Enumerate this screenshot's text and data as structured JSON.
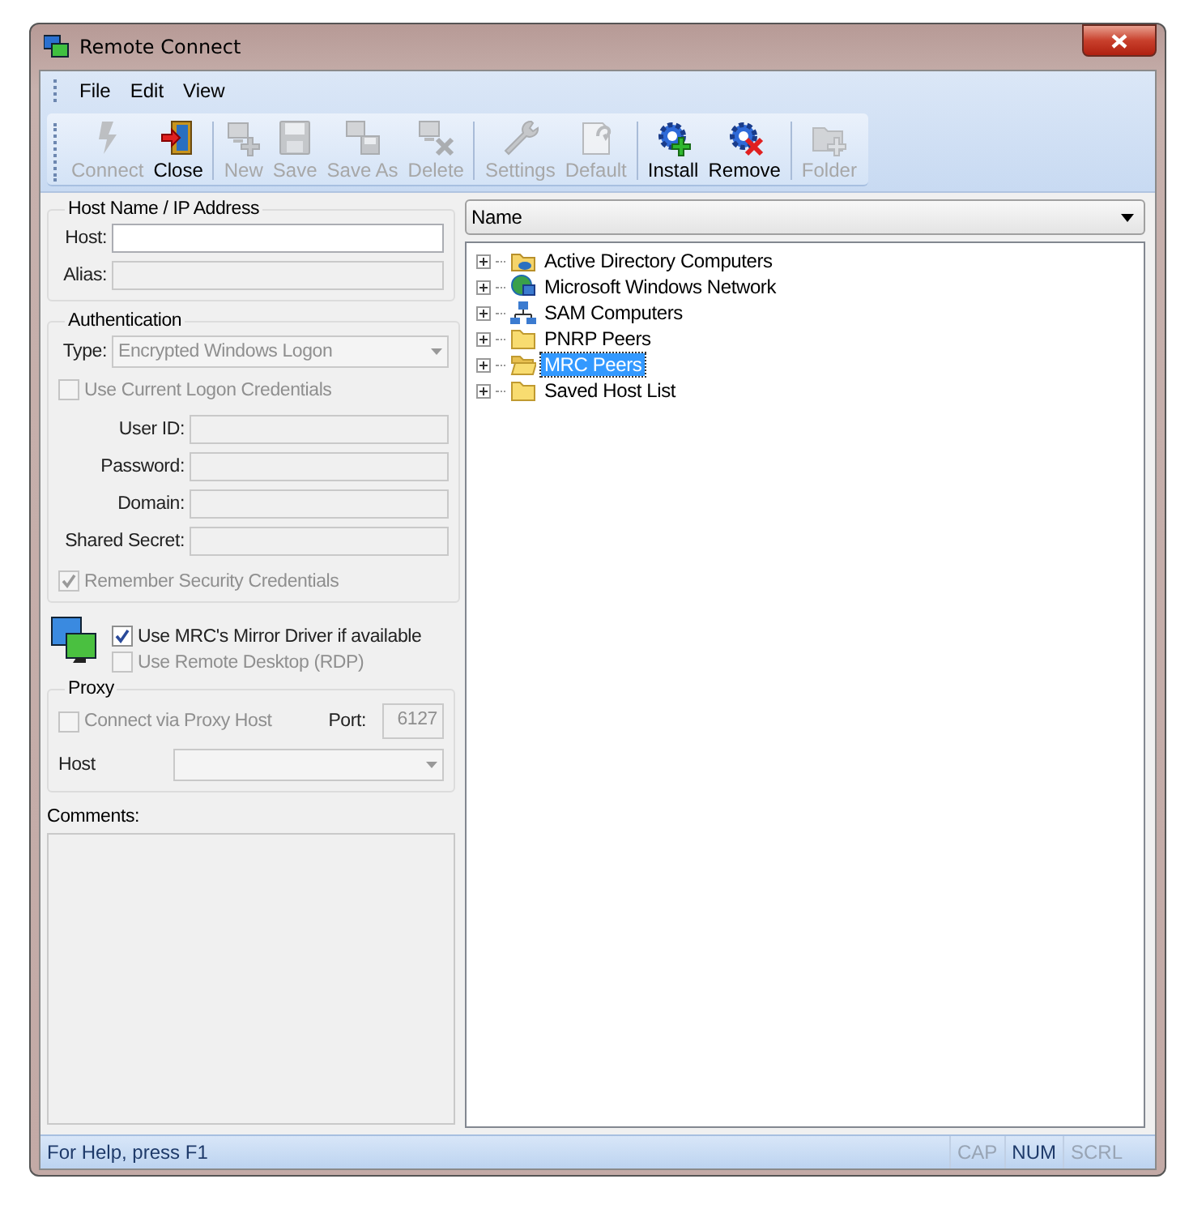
{
  "window": {
    "title": "Remote Connect"
  },
  "menu": [
    {
      "label": "File"
    },
    {
      "label": "Edit"
    },
    {
      "label": "View"
    }
  ],
  "toolbar": [
    {
      "buttons": [
        {
          "label": "Connect",
          "kind": "bolt",
          "disabled": true
        },
        {
          "label": "Close",
          "kind": "door",
          "disabled": false
        }
      ]
    },
    {
      "buttons": [
        {
          "label": "New",
          "kind": "computer-plus",
          "disabled": true
        },
        {
          "label": "Save",
          "kind": "floppy",
          "disabled": true
        },
        {
          "label": "Save As",
          "kind": "computer-floppy",
          "disabled": true
        },
        {
          "label": "Delete",
          "kind": "computer-x",
          "disabled": true
        }
      ]
    },
    {
      "buttons": [
        {
          "label": "Settings",
          "kind": "wrench",
          "disabled": true
        },
        {
          "label": "Default",
          "kind": "page",
          "disabled": true
        }
      ]
    },
    {
      "buttons": [
        {
          "label": "Install",
          "kind": "gear-plus",
          "disabled": false
        },
        {
          "label": "Remove",
          "kind": "gear-x",
          "disabled": false
        }
      ]
    },
    {
      "buttons": [
        {
          "label": "Folder",
          "kind": "folder-plus",
          "disabled": true
        }
      ]
    }
  ],
  "host_section": {
    "title": "Host Name / IP Address",
    "fields": [
      {
        "label": "Host:",
        "disabled": false
      },
      {
        "label": "Alias:",
        "disabled": true
      }
    ]
  },
  "authentication": {
    "title": "Authentication",
    "type_label": "Type:",
    "type_value": "Encrypted Windows Logon",
    "type_disabled": true,
    "use_current": {
      "label": "Use Current Logon Credentials",
      "checked": false,
      "disabled": true
    },
    "fields": [
      {
        "label": "User ID:",
        "disabled": true
      },
      {
        "label": "Password:",
        "disabled": true
      },
      {
        "label": "Domain:",
        "disabled": true
      },
      {
        "label": "Shared Secret:",
        "disabled": true
      }
    ],
    "remember": {
      "label": "Remember Security Credentials",
      "checked": true,
      "disabled": true
    }
  },
  "options": [
    {
      "label": "Use MRC's Mirror Driver if available",
      "checked": true,
      "disabled": false
    },
    {
      "label": "Use Remote Desktop (RDP)",
      "checked": false,
      "disabled": true
    }
  ],
  "proxy": {
    "title": "Proxy",
    "connect": {
      "label": "Connect via Proxy Host",
      "checked": false,
      "disabled": true
    },
    "port_label": "Port:",
    "port_value": "6127",
    "host_label": "Host"
  },
  "comments": {
    "label": "Comments:"
  },
  "tree": {
    "header": "Name",
    "items": [
      {
        "label": "Active Directory Computers",
        "kind": "directory",
        "expanded": false,
        "selected": false
      },
      {
        "label": "Microsoft Windows Network",
        "kind": "network",
        "expanded": false,
        "selected": false
      },
      {
        "label": "SAM Computers",
        "kind": "sam",
        "expanded": false,
        "selected": false
      },
      {
        "label": "PNRP Peers",
        "kind": "folder",
        "expanded": false,
        "selected": false
      },
      {
        "label": "MRC Peers",
        "kind": "folder-open",
        "expanded": false,
        "selected": true
      },
      {
        "label": "Saved Host List",
        "kind": "folder",
        "expanded": false,
        "selected": false
      }
    ]
  },
  "status_bar": {
    "text": "For Help, press F1",
    "indicators": [
      {
        "label": "CAP",
        "on": false
      },
      {
        "label": "NUM",
        "on": true
      },
      {
        "label": "SCRL",
        "on": false
      }
    ]
  }
}
